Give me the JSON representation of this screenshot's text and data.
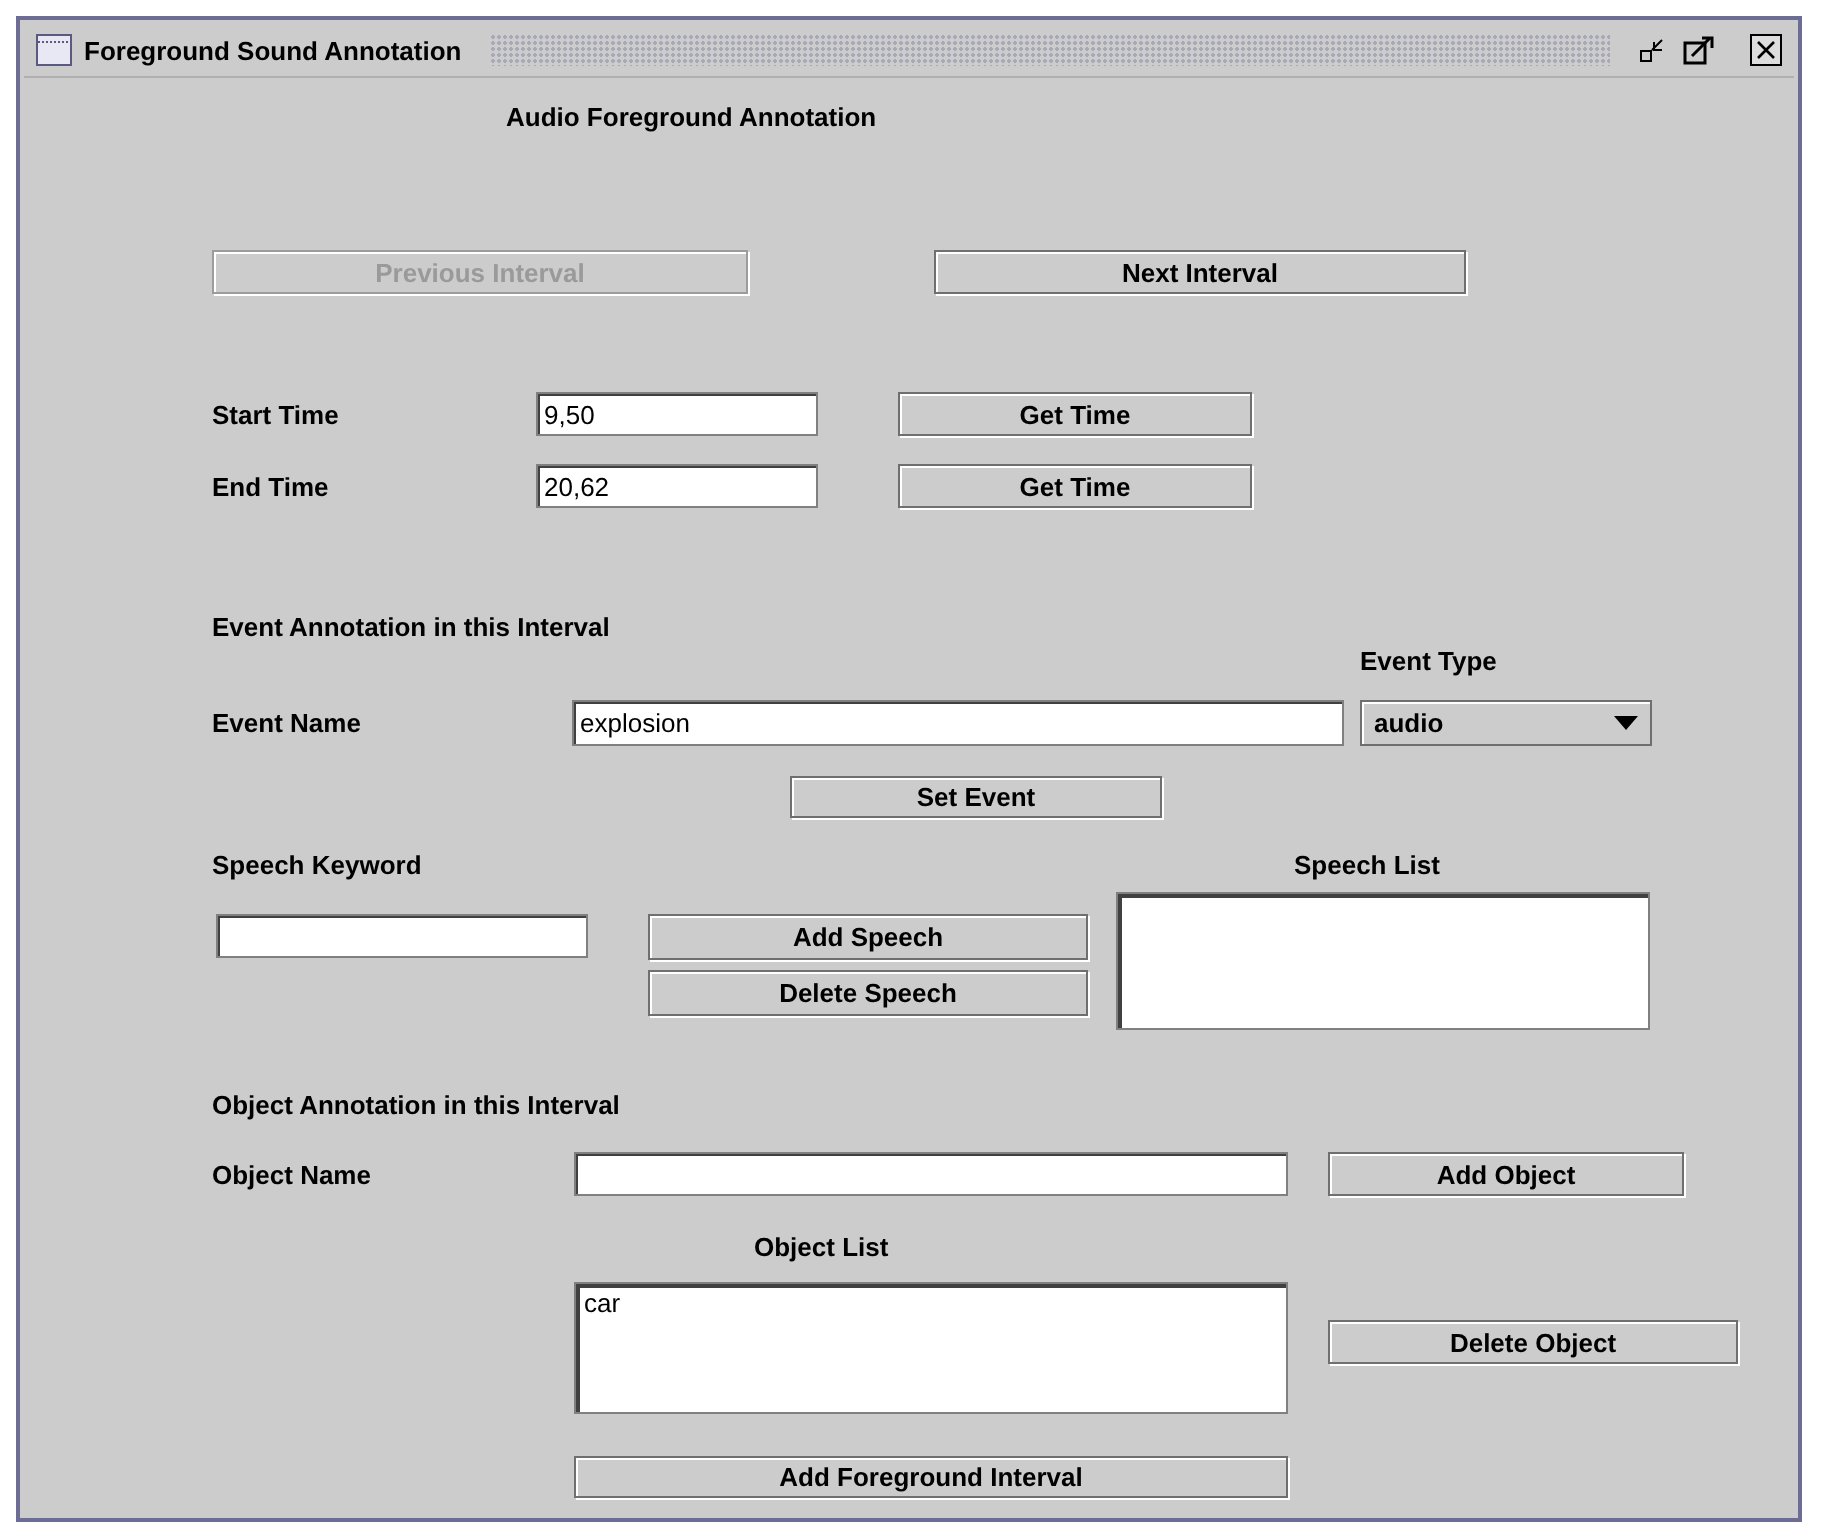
{
  "window": {
    "title": "Foreground Sound Annotation"
  },
  "heading": "Audio Foreground Annotation",
  "navigation": [
    {
      "label": "Previous Interval",
      "disabled": true
    },
    {
      "label": "Next Interval",
      "disabled": false
    }
  ],
  "times": [
    {
      "label": "Start Time",
      "value": "9,50",
      "button": "Get Time"
    },
    {
      "label": "End Time",
      "value": "20,62",
      "button": "Get Time"
    }
  ],
  "event": {
    "section": "Event Annotation in this Interval",
    "type_label": "Event Type",
    "name_label": "Event Name",
    "name_value": "explosion",
    "type_value": "audio",
    "set_button": "Set Event"
  },
  "speech": {
    "keyword_label": "Speech Keyword",
    "list_label": "Speech List",
    "add_button": "Add Speech",
    "delete_button": "Delete Speech"
  },
  "object": {
    "section": "Object Annotation in this Interval",
    "name_label": "Object Name",
    "add_button": "Add Object",
    "list_label": "Object List",
    "items": [
      "car"
    ],
    "delete_button": "Delete Object"
  },
  "add_interval_button": "Add Foreground Interval"
}
